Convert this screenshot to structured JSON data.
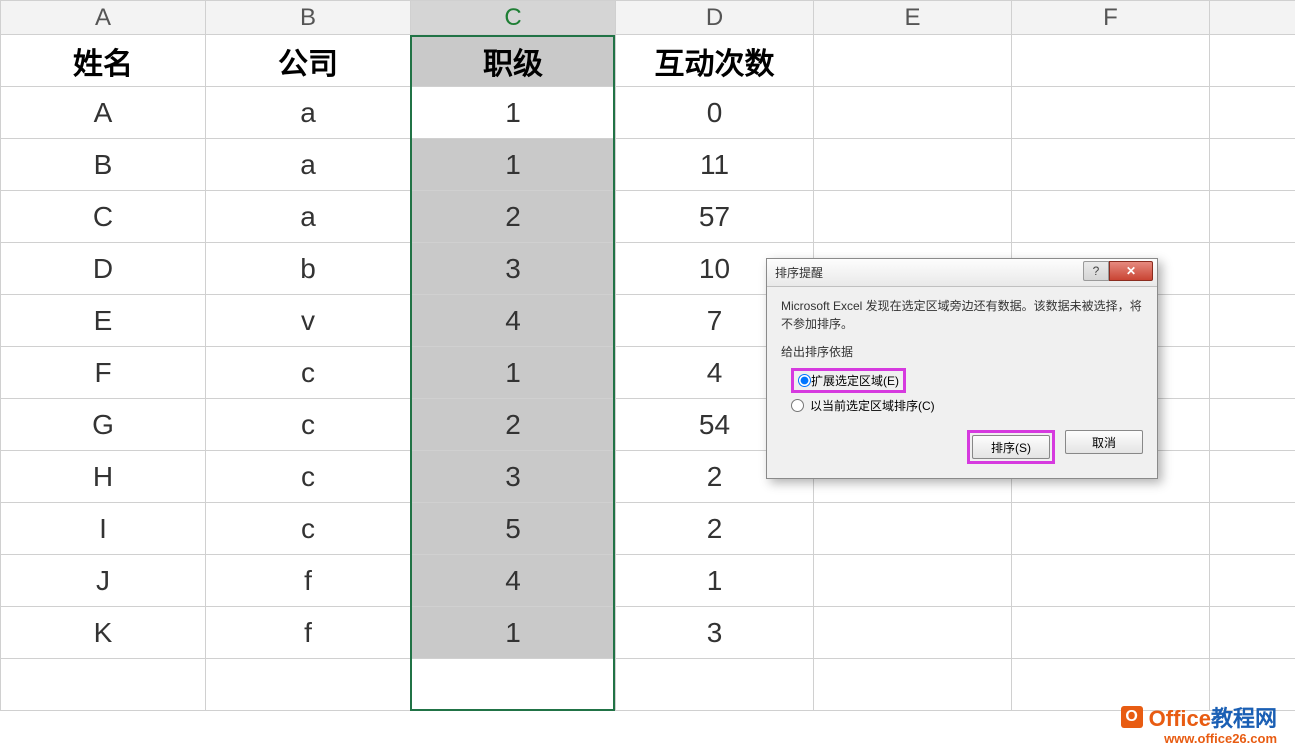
{
  "columns": [
    "A",
    "B",
    "C",
    "D",
    "E",
    "F"
  ],
  "headers": {
    "A": "姓名",
    "B": "公司",
    "C": "职级",
    "D": "互动次数"
  },
  "rows": [
    {
      "A": "A",
      "B": "a",
      "C": "1",
      "D": "0"
    },
    {
      "A": "B",
      "B": "a",
      "C": "1",
      "D": "11"
    },
    {
      "A": "C",
      "B": "a",
      "C": "2",
      "D": "57"
    },
    {
      "A": "D",
      "B": "b",
      "C": "3",
      "D": "10"
    },
    {
      "A": "E",
      "B": "v",
      "C": "4",
      "D": "7"
    },
    {
      "A": "F",
      "B": "c",
      "C": "1",
      "D": "4"
    },
    {
      "A": "G",
      "B": "c",
      "C": "2",
      "D": "54"
    },
    {
      "A": "H",
      "B": "c",
      "C": "3",
      "D": "2"
    },
    {
      "A": "I",
      "B": "c",
      "C": "5",
      "D": "2"
    },
    {
      "A": "J",
      "B": "f",
      "C": "4",
      "D": "1"
    },
    {
      "A": "K",
      "B": "f",
      "C": "1",
      "D": "3"
    }
  ],
  "selected_column": "C",
  "dialog": {
    "title": "排序提醒",
    "message": "Microsoft Excel 发现在选定区域旁边还有数据。该数据未被选择，将不参加排序。",
    "group_label": "给出排序依据",
    "option_expand": "扩展选定区域(E)",
    "option_current": "以当前选定区域排序(C)",
    "selected_option": "expand",
    "sort_btn": "排序(S)",
    "cancel_btn": "取消",
    "help_label": "?",
    "close_label": "✕"
  },
  "watermark": {
    "brand_a": "Office",
    "brand_b": "教程网",
    "url": "www.office26.com",
    "icon_letter": "O"
  }
}
